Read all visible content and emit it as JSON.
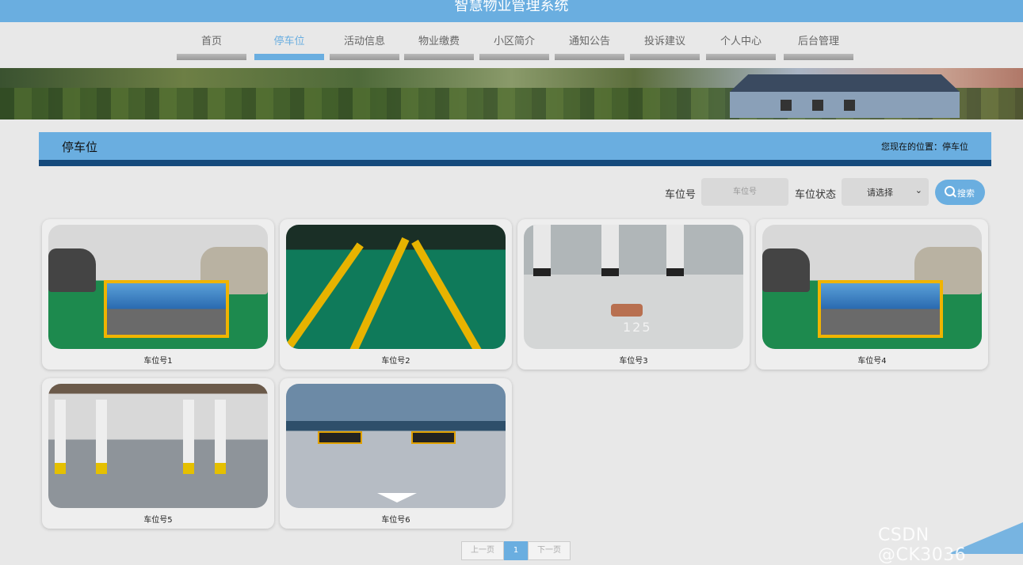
{
  "header": {
    "title": "智慧物业管理系统"
  },
  "nav": [
    {
      "label": "首页",
      "active": false
    },
    {
      "label": "停车位",
      "active": true
    },
    {
      "label": "活动信息",
      "active": false
    },
    {
      "label": "物业缴费",
      "active": false
    },
    {
      "label": "小区简介",
      "active": false
    },
    {
      "label": "通知公告",
      "active": false
    },
    {
      "label": "投诉建议",
      "active": false
    },
    {
      "label": "个人中心",
      "active": false
    },
    {
      "label": "后台管理",
      "active": false
    }
  ],
  "section": {
    "title": "停车位",
    "location": "您现在的位置：停车位"
  },
  "search": {
    "number_label": "车位号",
    "number_placeholder": "车位号",
    "status_label": "车位状态",
    "status_value": "请选择",
    "button_label": "搜索"
  },
  "cards": [
    {
      "caption": "车位号1"
    },
    {
      "caption": "车位号2"
    },
    {
      "caption": "车位号3"
    },
    {
      "caption": "车位号4"
    },
    {
      "caption": "车位号5"
    },
    {
      "caption": "车位号6"
    }
  ],
  "pagination": {
    "prev": "上一页",
    "current": "1",
    "next": "下一页"
  },
  "watermark": "CSDN @CK3036",
  "colors": {
    "accent": "#6aaee0",
    "accent_dark": "#154a7c"
  }
}
